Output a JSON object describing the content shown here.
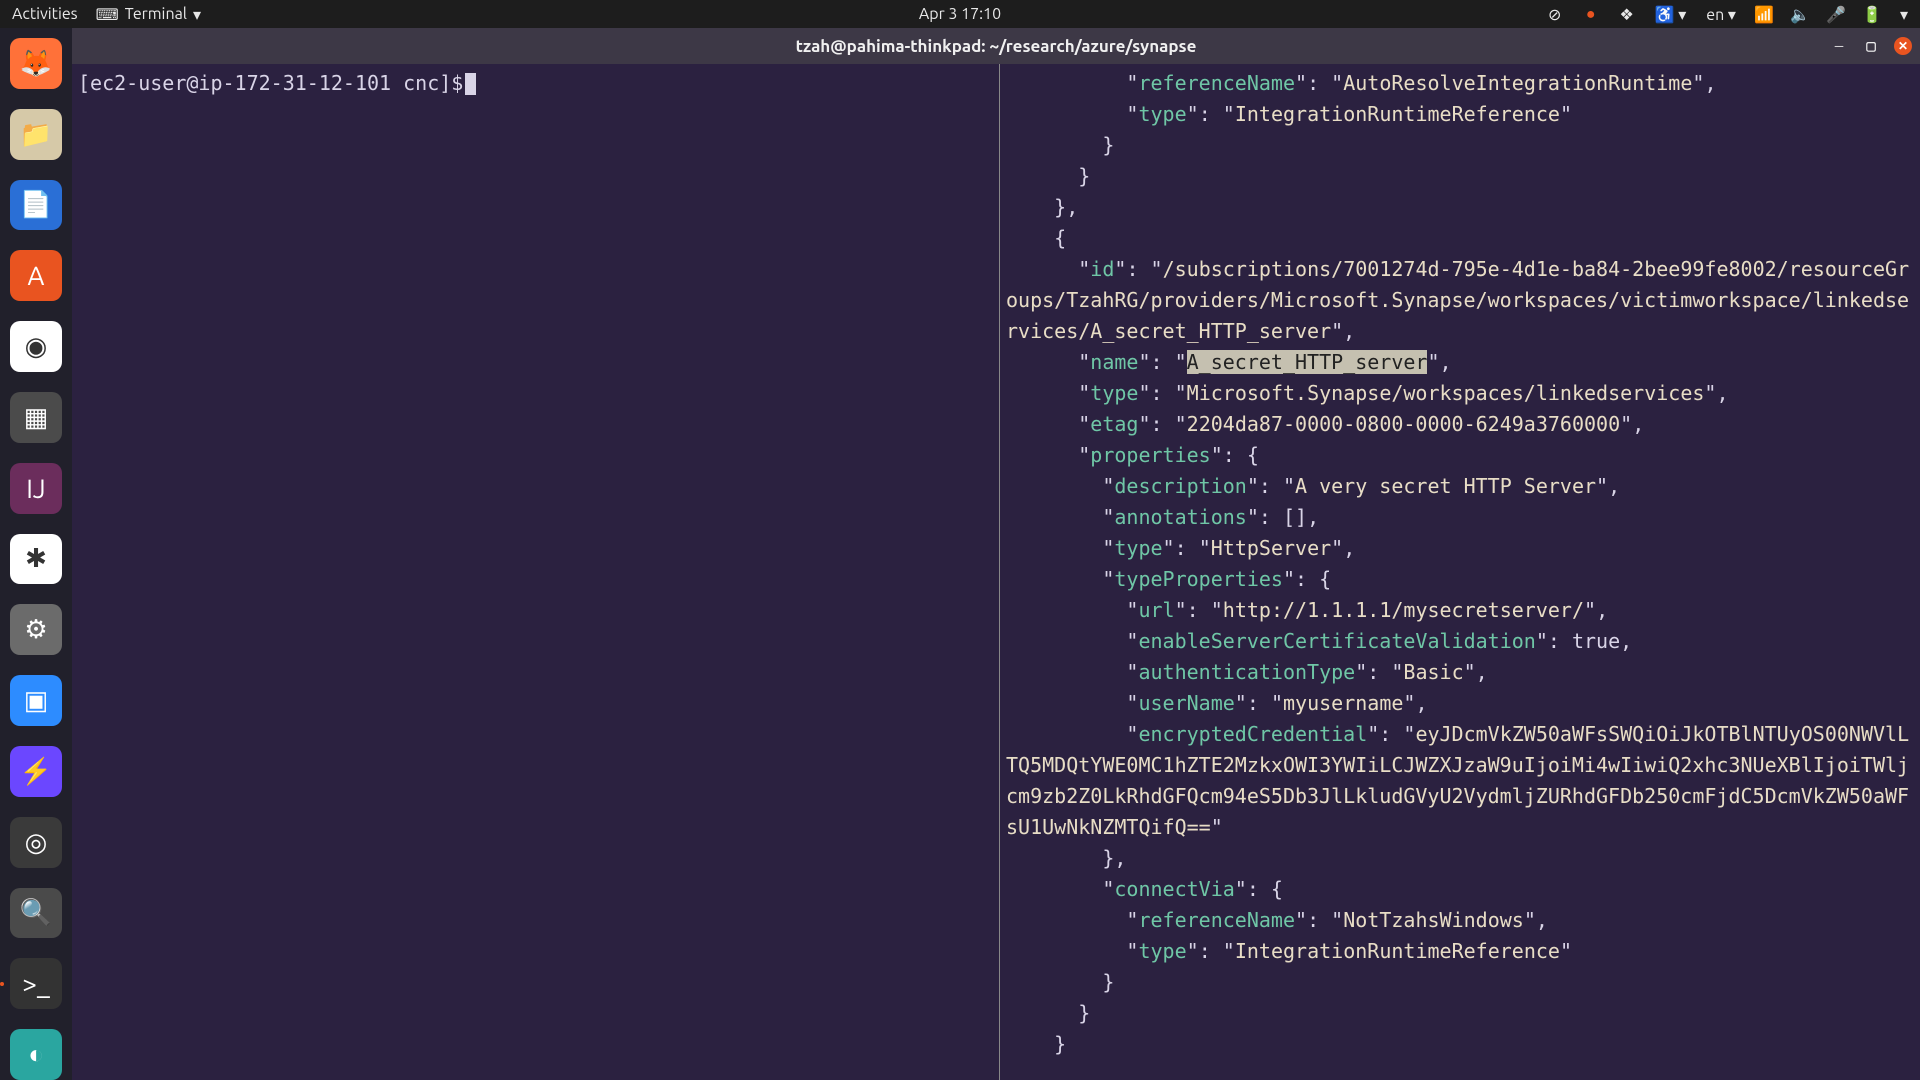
{
  "topbar": {
    "activities": "Activities",
    "app_name": "Terminal",
    "clock": "Apr 3  17:10",
    "lang": "en"
  },
  "dock": {
    "items": [
      {
        "name": "firefox",
        "bg": "#ff7139",
        "glyph": "🦊"
      },
      {
        "name": "files",
        "bg": "#d6c9a8",
        "glyph": "📁"
      },
      {
        "name": "libreoffice-writer",
        "bg": "#2a6fd6",
        "glyph": "📄"
      },
      {
        "name": "software",
        "bg": "#e95420",
        "glyph": "A"
      },
      {
        "name": "chrome",
        "bg": "#ffffff",
        "glyph": "◉"
      },
      {
        "name": "sublime",
        "bg": "#4b4b4b",
        "glyph": "▦"
      },
      {
        "name": "intellij",
        "bg": "#6b2d5c",
        "glyph": "IJ"
      },
      {
        "name": "slack",
        "bg": "#ffffff",
        "glyph": "✱"
      },
      {
        "name": "settings",
        "bg": "#6b6b6b",
        "glyph": "⚙"
      },
      {
        "name": "zoom",
        "bg": "#2d8cff",
        "glyph": "▣"
      },
      {
        "name": "burp",
        "bg": "#6b47ff",
        "glyph": "⚡"
      },
      {
        "name": "obs",
        "bg": "#3a3a3a",
        "glyph": "◎"
      },
      {
        "name": "image-viewer",
        "bg": "#4a4a4a",
        "glyph": "🔍"
      },
      {
        "name": "terminal",
        "bg": "#333333",
        "glyph": ">_",
        "running": true
      },
      {
        "name": "azure-data-studio",
        "bg": "#2aa6a0",
        "glyph": "◐"
      }
    ]
  },
  "window": {
    "title": "tzah@pahima-thinkpad: ~/research/azure/synapse"
  },
  "left_pane": {
    "prompt": "[ec2-user@ip-172-31-12-101 cnc]$"
  },
  "json": {
    "prev_block": {
      "referenceName": "AutoResolveIntegrationRuntime",
      "type": "IntegrationRuntimeReference"
    },
    "item": {
      "id": "/subscriptions/7001274d-795e-4d1e-ba84-2bee99fe8002/resourceGroups/TzahRG/providers/Microsoft.Synapse/workspaces/victimworkspace/linkedservices/A_secret_HTTP_server",
      "name": "A_secret_HTTP_server",
      "type": "Microsoft.Synapse/workspaces/linkedservices",
      "etag": "2204da87-0000-0800-0000-6249a3760000",
      "properties": {
        "description": "A very secret HTTP Server",
        "annotations": "[]",
        "type": "HttpServer",
        "typeProperties": {
          "url": "http://1.1.1.1/mysecretserver/",
          "enableServerCertificateValidation": "true",
          "authenticationType": "Basic",
          "userName": "myusername",
          "encryptedCredential": "eyJDcmVkZW50aWFsSWQiOiJkOTBlNTUyOS00NWVlLTQ5MDQtYWE0MC1hZTE2MzkxOWI3YWIiLCJWZXJzaW9uIjoiMi4wIiwiQ2xhc3NUeXBlIjoiTWljcm9zb2Z0LkRhdGFQcm94eS5Db3JlLkludGVyU2VydmljZURhdGFDb250cmFjdC5DcmVkZW50aWFsU1UwNkNZMTQifQ=="
        },
        "connectVia": {
          "referenceName": "NotTzahsWindows",
          "type": "IntegrationRuntimeReference"
        }
      }
    }
  }
}
